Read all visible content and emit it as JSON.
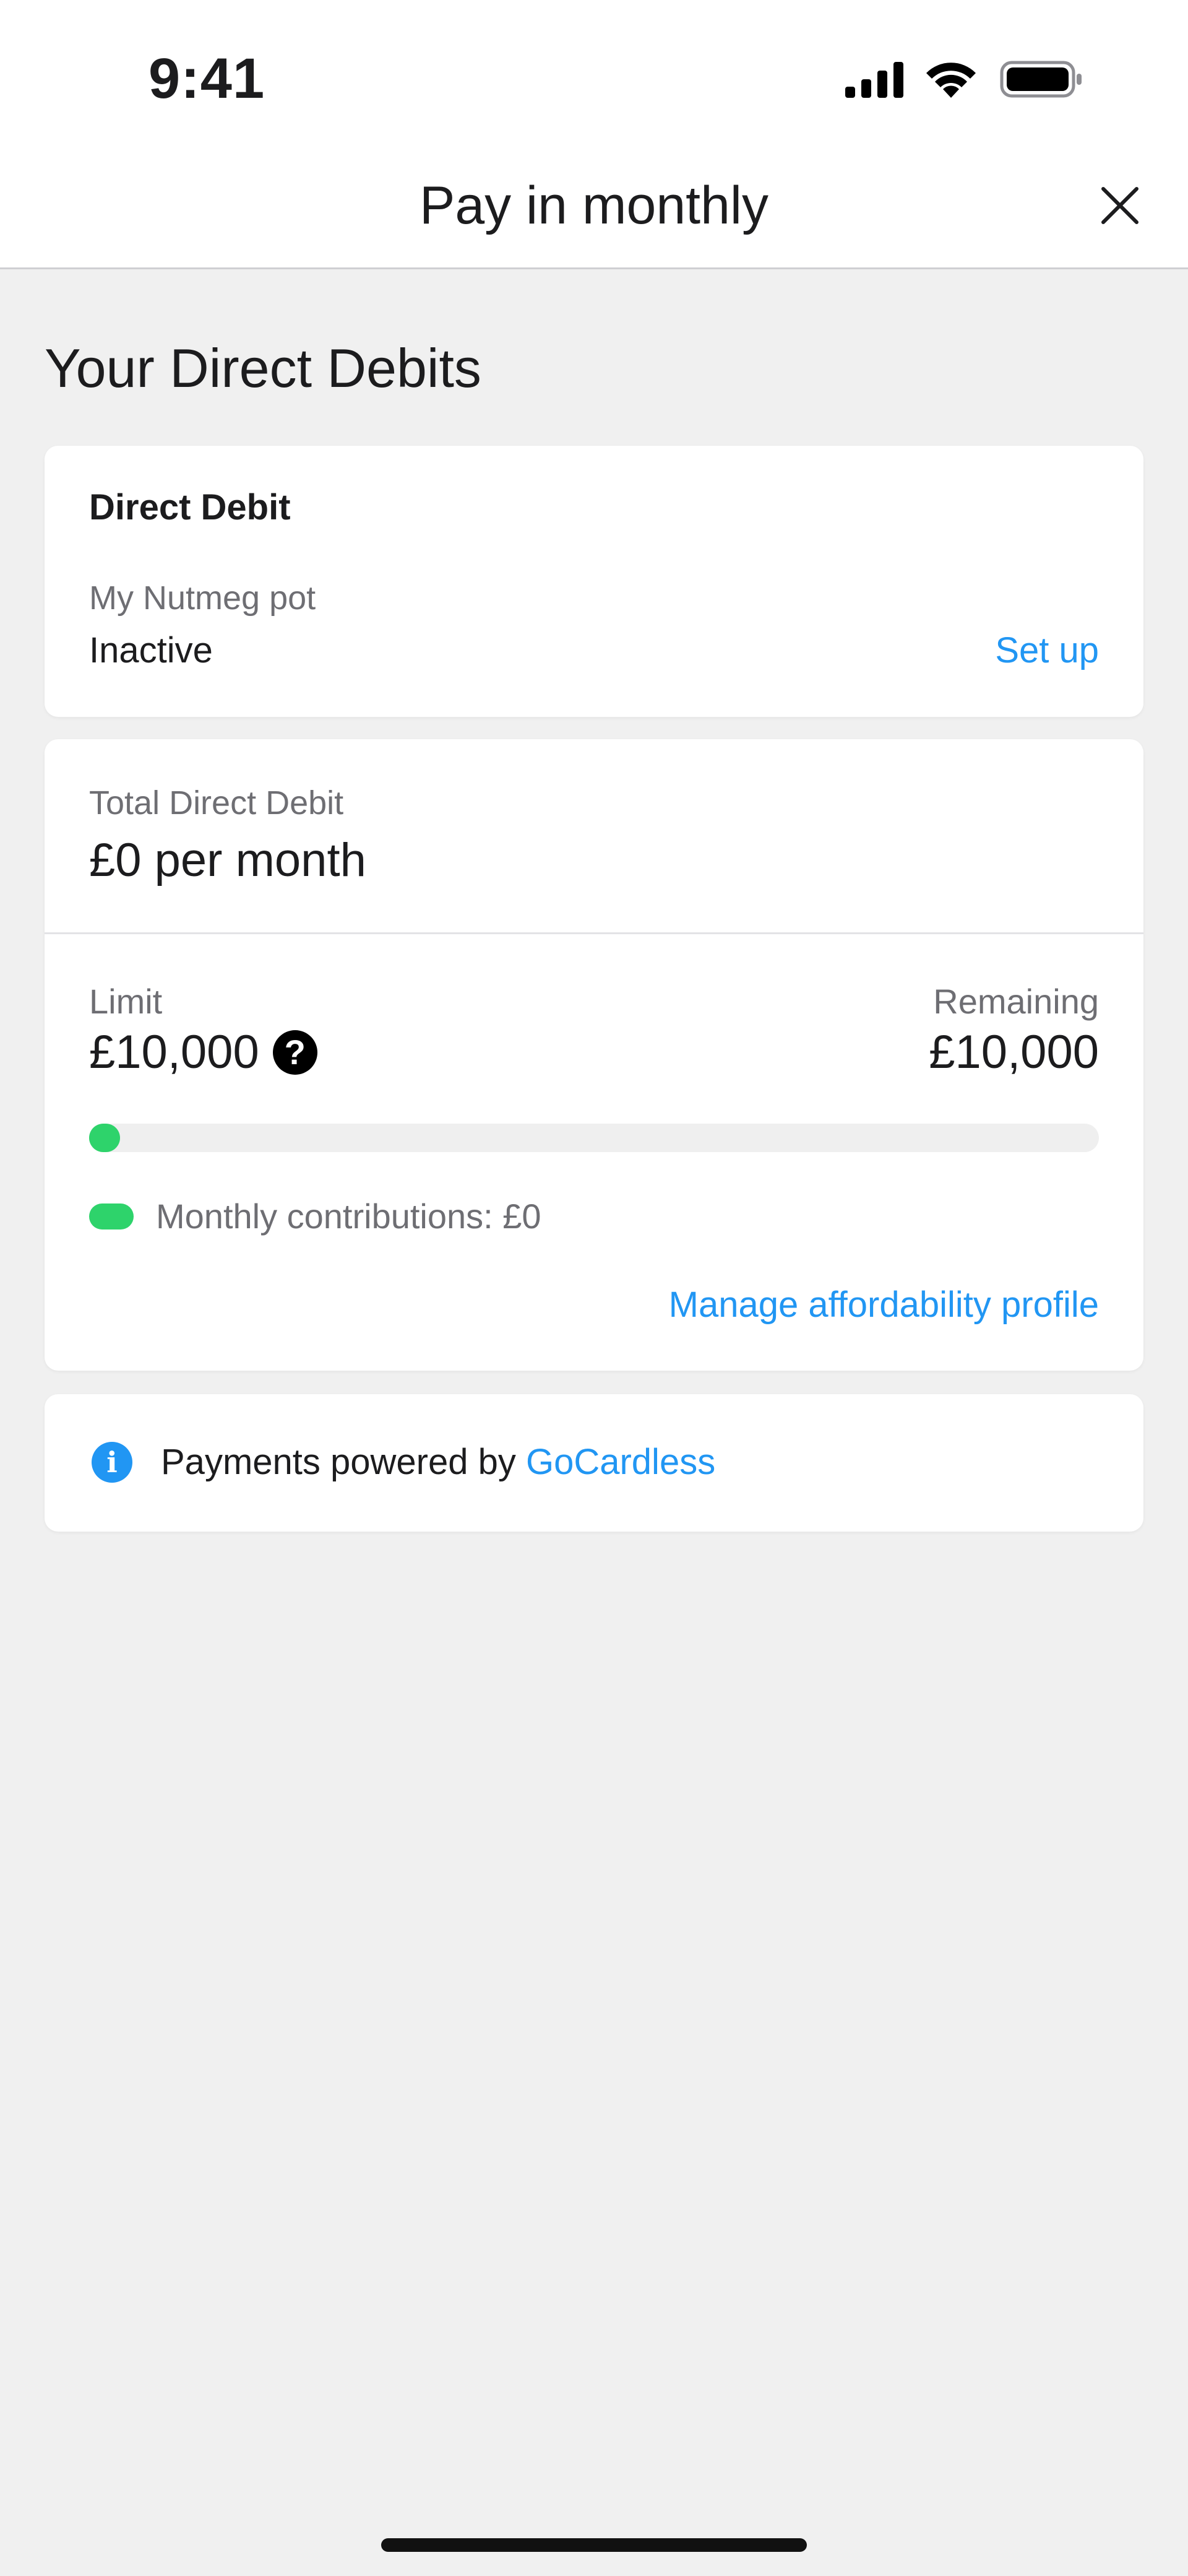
{
  "status_bar": {
    "time": "9:41"
  },
  "nav": {
    "title": "Pay in monthly",
    "close_icon": "close-icon"
  },
  "page": {
    "section_title": "Your Direct Debits"
  },
  "direct_debit_card": {
    "heading": "Direct Debit",
    "pot_name": "My Nutmeg pot",
    "status": "Inactive",
    "action_label": "Set up"
  },
  "total_card": {
    "total_label": "Total Direct Debit",
    "total_value": "£0 per month",
    "limit_label": "Limit",
    "limit_value": "£10,000",
    "remaining_label": "Remaining",
    "remaining_value": "£10,000",
    "progress_fraction": 0,
    "legend_label": "Monthly contributions: £0",
    "manage_label": "Manage affordability profile"
  },
  "powered_card": {
    "text": "Payments powered by ",
    "provider": "GoCardless"
  },
  "colors": {
    "accent": "#2196f3",
    "progress": "#2ed36b",
    "background": "#f0f0f0"
  }
}
